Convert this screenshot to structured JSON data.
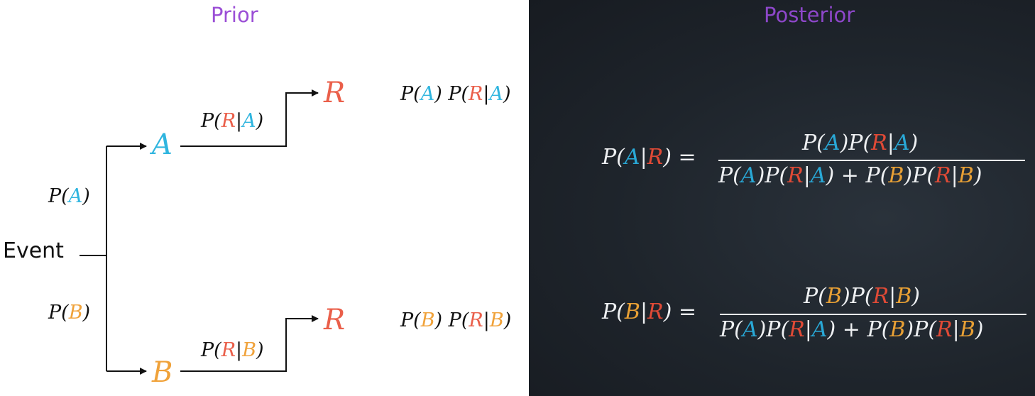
{
  "headers": {
    "prior": "Prior",
    "posterior": "Posterior"
  },
  "tree": {
    "root": "Event",
    "node_a": "A",
    "node_b": "B",
    "leaf_top": "R",
    "leaf_bottom": "R",
    "edge_pa": {
      "p": "P(",
      "v": "A",
      "c": ")"
    },
    "edge_pb": {
      "p": "P(",
      "v": "B",
      "c": ")"
    },
    "edge_ra": {
      "p": "P(",
      "r": "R",
      "bar": "|",
      "v": "A",
      "c": ")"
    },
    "edge_rb": {
      "p": "P(",
      "r": "R",
      "bar": "|",
      "v": "B",
      "c": ")"
    }
  },
  "joint": {
    "top": {
      "p1": "P(",
      "v1": "A",
      "c1": ")",
      "p2": " P(",
      "r": "R",
      "bar": "|",
      "v2": "A",
      "c2": ")"
    },
    "bottom": {
      "p1": "P(",
      "v1": "B",
      "c1": ")",
      "p2": " P(",
      "r": "R",
      "bar": "|",
      "v2": "B",
      "c2": ")"
    }
  },
  "posterior": {
    "eq1": {
      "lhs": {
        "p": "P(",
        "v": "A",
        "bar": "|",
        "r": "R",
        "c": ")",
        "eq": " = "
      },
      "num": {
        "p1": "P(",
        "v1": "A",
        "c1": ")",
        "p2": "P(",
        "r": "R",
        "bar": "|",
        "v2": "A",
        "c2": ")"
      }
    },
    "eq2": {
      "lhs": {
        "p": "P(",
        "v": "B",
        "bar": "|",
        "r": "R",
        "c": ")",
        "eq": " = "
      },
      "num": {
        "p1": "P(",
        "v1": "B",
        "c1": ")",
        "p2": "P(",
        "r": "R",
        "bar": "|",
        "v2": "B",
        "c2": ")"
      }
    },
    "den": {
      "p1": "P(",
      "a": "A",
      "c1": ")",
      "p2": "P(",
      "r1": "R",
      "bar1": "|",
      "a2": "A",
      "c2": ")",
      "plus": " + ",
      "p3": "P(",
      "b": "B",
      "c3": ")",
      "p4": "P(",
      "r2": "R",
      "bar2": "|",
      "b2": "B",
      "c4": ")"
    }
  }
}
